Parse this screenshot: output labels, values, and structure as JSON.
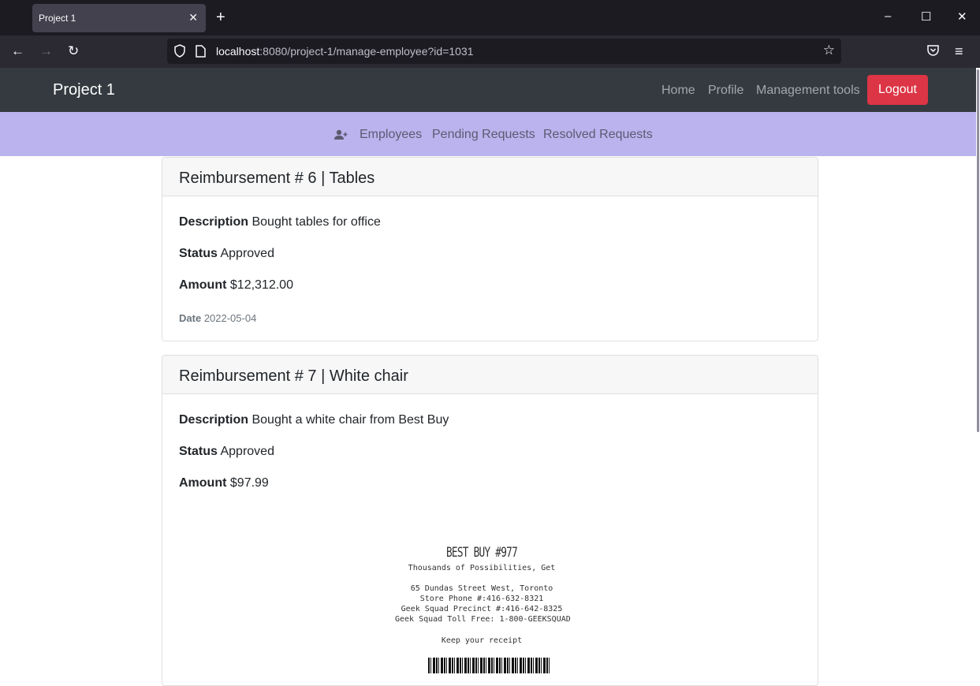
{
  "browser": {
    "tab_title": "Project 1",
    "tab_close": "✕",
    "new_tab": "+",
    "url_host": "localhost",
    "url_rest": ":8080/project-1/manage-employee?id=1031"
  },
  "app": {
    "brand": "Project 1",
    "nav": {
      "home": "Home",
      "profile": "Profile",
      "management": "Management tools",
      "logout": "Logout"
    },
    "subnav": {
      "employees": "Employees",
      "pending": "Pending Requests",
      "resolved": "Resolved Requests"
    },
    "colors": {
      "navbar": "#343a40",
      "subnav": "#bbb3ed",
      "logout": "#dc3545"
    }
  },
  "reimbursements": [
    {
      "title": "Reimbursement # 6 | Tables",
      "description_label": "Description",
      "description": "Bought tables for office",
      "status_label": "Status",
      "status": "Approved",
      "amount_label": "Amount",
      "amount": "$12,312.00",
      "date_label": "Date",
      "date": "2022-05-04"
    },
    {
      "title": "Reimbursement # 7 | White chair",
      "description_label": "Description",
      "description": "Bought a white chair from Best Buy",
      "status_label": "Status",
      "status": "Approved",
      "amount_label": "Amount",
      "amount": "$97.99",
      "receipt": {
        "store": "BEST BUY #977",
        "tagline": "Thousands of Possibilities, Get",
        "address": "65 Dundas Street West, Toronto",
        "phone": "Store Phone #:416-632-8321",
        "precinct": "Geek Squad Precinct #:416-642-8325",
        "tollfree": "Geek Squad Toll Free: 1-800-GEEKSQUAD",
        "keep": "Keep your receipt"
      }
    }
  ]
}
